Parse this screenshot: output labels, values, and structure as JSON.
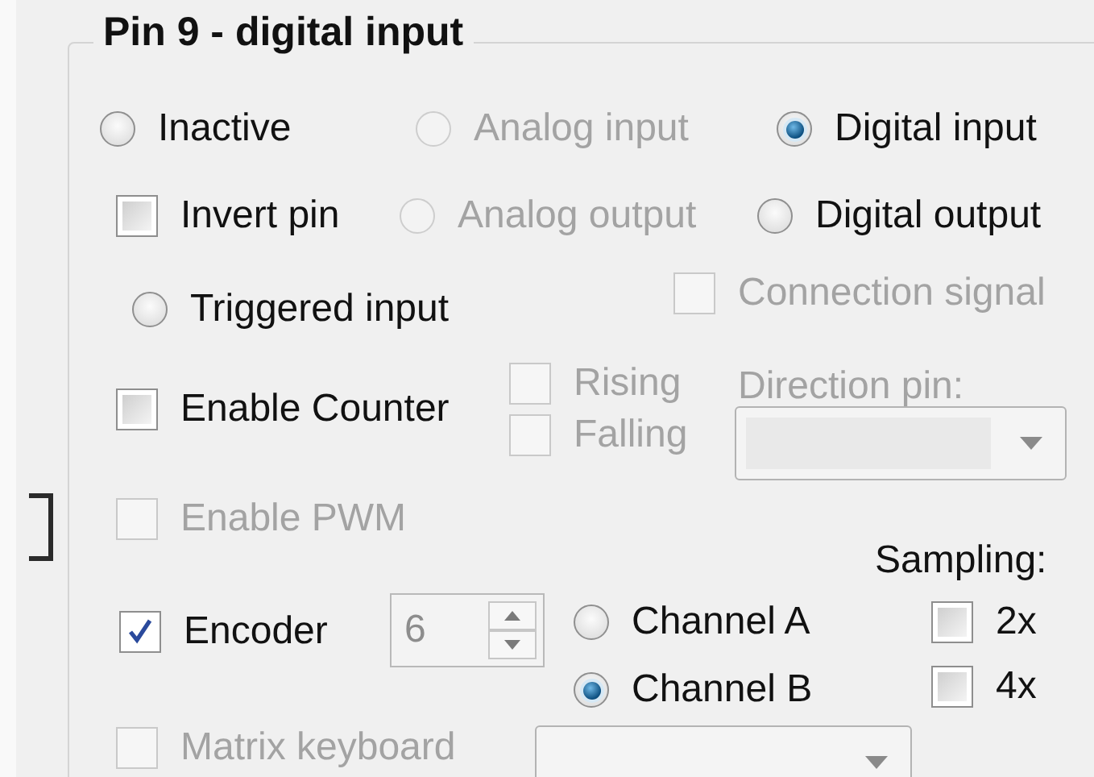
{
  "group_title": "Pin 9 - digital input",
  "pin_modes": [
    {
      "label": "Inactive",
      "selected": false,
      "disabled": false
    },
    {
      "label": "Analog input",
      "selected": false,
      "disabled": true
    },
    {
      "label": "Digital input",
      "selected": true,
      "disabled": false
    },
    {
      "label": "Analog output",
      "selected": false,
      "disabled": true
    },
    {
      "label": "Digital output",
      "selected": false,
      "disabled": false
    },
    {
      "label": "Triggered input",
      "selected": false,
      "disabled": false
    }
  ],
  "options": [
    {
      "label": "Invert pin",
      "checked": false,
      "disabled": false
    },
    {
      "label": "Connection signal",
      "checked": false,
      "disabled": true
    },
    {
      "label": "Enable Counter",
      "checked": false,
      "disabled": false
    },
    {
      "label": "Rising",
      "checked": false,
      "disabled": true
    },
    {
      "label": "Falling",
      "checked": false,
      "disabled": true
    },
    {
      "label": "Enable PWM",
      "checked": false,
      "disabled": true
    },
    {
      "label": "Encoder",
      "checked": true,
      "disabled": false
    },
    {
      "label": "Matrix keyboard",
      "checked": false,
      "disabled": true
    }
  ],
  "direction_pin": {
    "label": "Direction pin:",
    "disabled": true
  },
  "encoder_count": {
    "value": "6",
    "disabled": true
  },
  "channels": [
    {
      "label": "Channel A",
      "selected": false
    },
    {
      "label": "Channel B",
      "selected": true
    }
  ],
  "sampling": {
    "label": "Sampling:",
    "options": [
      {
        "label": "2x",
        "checked": false
      },
      {
        "label": "4x",
        "checked": false
      }
    ]
  }
}
